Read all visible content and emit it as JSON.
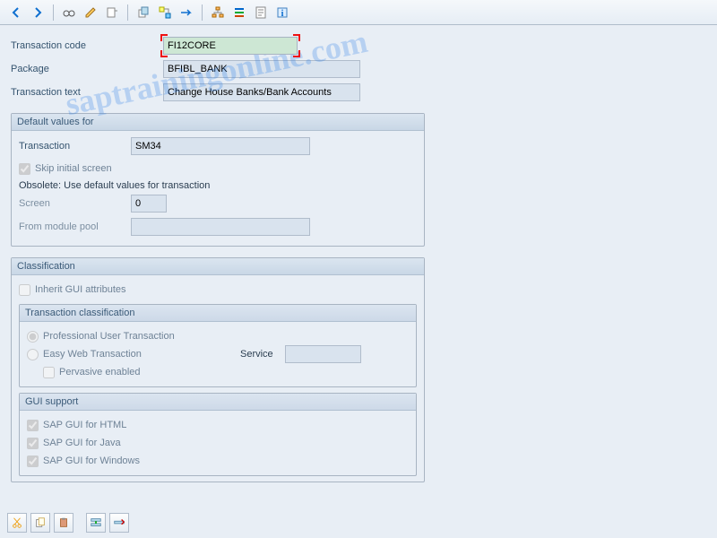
{
  "header": {
    "transaction_code_label": "Transaction code",
    "transaction_code_value": "FI12CORE",
    "package_label": "Package",
    "package_value": "BFIBL_BANK",
    "transaction_text_label": "Transaction text",
    "transaction_text_value": "Change House Banks/Bank Accounts"
  },
  "defaults": {
    "title": "Default values for",
    "transaction_label": "Transaction",
    "transaction_value": "SM34",
    "skip_label": "Skip initial screen",
    "obsolete_text": "Obsolete: Use default values for transaction",
    "screen_label": "Screen",
    "screen_value": "0",
    "module_label": "From module pool",
    "module_value": ""
  },
  "classification": {
    "title": "Classification",
    "inherit_label": "Inherit GUI attributes",
    "trans_class_title": "Transaction classification",
    "radio_prof": "Professional User Transaction",
    "radio_easy": "Easy Web Transaction",
    "service_label": "Service",
    "service_value": "",
    "pervasive_label": "Pervasive enabled",
    "gui_support_title": "GUI support",
    "gui_html": "SAP GUI for HTML",
    "gui_java": "SAP GUI for Java",
    "gui_win": "SAP GUI for Windows"
  },
  "watermark": "saptrainingonline.com"
}
